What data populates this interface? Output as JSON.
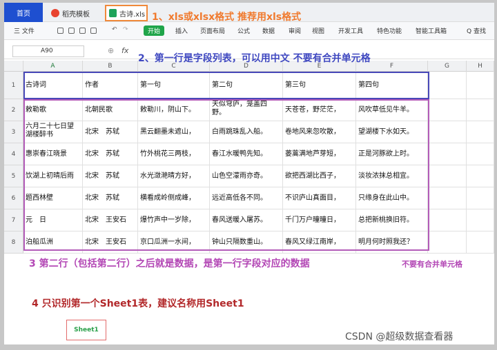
{
  "tabs": {
    "home": "首页",
    "wps": "稻壳模板",
    "file": "古诗.xls"
  },
  "toolbar": {
    "file_menu": "三 文件",
    "start": "开始",
    "items": [
      "插入",
      "页面布局",
      "公式",
      "数据",
      "审阅",
      "视图",
      "开发工具",
      "特色功能",
      "智能工具箱"
    ],
    "search": "Q 查找"
  },
  "formula": {
    "cell_ref": "A90",
    "fx": "fx"
  },
  "columns": [
    "A",
    "B",
    "C",
    "D",
    "E",
    "F",
    "G",
    "H"
  ],
  "rows": [
    "1",
    "2",
    "3",
    "4",
    "5",
    "6",
    "7",
    "8"
  ],
  "header_row": [
    "古诗词",
    "作者",
    "第一句",
    "第二句",
    "第三句",
    "第四句"
  ],
  "data_rows": [
    [
      "敕勒歌",
      "北朝民歌",
      "敕勒川，阴山下。",
      "天似穹庐，笼盖四野。",
      "天苍苍，野茫茫，",
      "风吹草低见牛羊。"
    ],
    [
      "六月二十七日望湖楼醉书",
      "北宋　苏轼",
      "黑云翻墨未遮山，",
      "白雨跳珠乱入船。",
      "卷地风来忽吹散，",
      "望湖楼下水如天。"
    ],
    [
      "惠崇春江晓景",
      "北宋　苏轼",
      "竹外桃花三两枝，",
      "春江水暖鸭先知。",
      "蒌蒿满地芦芽短，",
      "正是河豚欲上时。"
    ],
    [
      "饮湖上初晴后雨",
      "北宋　苏轼",
      "水光潋滟晴方好，",
      "山色空濛雨亦奇。",
      "欲把西湖比西子，",
      "淡妆浓抹总相宜。"
    ],
    [
      "题西林壁",
      "北宋　苏轼",
      "横看成岭侧成峰，",
      "远近高低各不同。",
      "不识庐山真面目，",
      "只缘身在此山中。"
    ],
    [
      "元　日",
      "北宋　王安石",
      "爆竹声中一岁除，",
      "春风送暖入屠苏。",
      "千门万户曈曈日，",
      "总把新桃换旧符。"
    ],
    [
      "泊船瓜洲",
      "北宋　王安石",
      "京口瓜洲一水间，",
      "钟山只隔数重山。",
      "春风又绿江南岸，",
      "明月何时照我还？"
    ]
  ],
  "annotations": {
    "a1": "1、xls或xlsx格式 推荐用xls格式",
    "a2": "2、第一行是字段列表，可以用中文 不要有合并单元格",
    "a3": "3 第二行（包括第二行）之后就是数据，是第一行字段对应的数据",
    "a3b": "不要有合并单元格",
    "a4": "4 只识别第一个Sheet1表，建议名称用Sheet1"
  },
  "sheet_tab": "Sheet1",
  "watermark": "CSDN @超级数据查看器",
  "colors": {
    "blue_box": "#4848b8",
    "purple_box": "#b35bb8",
    "orange": "#f07a2e",
    "red": "#b2282a",
    "green": "#20a54a"
  }
}
